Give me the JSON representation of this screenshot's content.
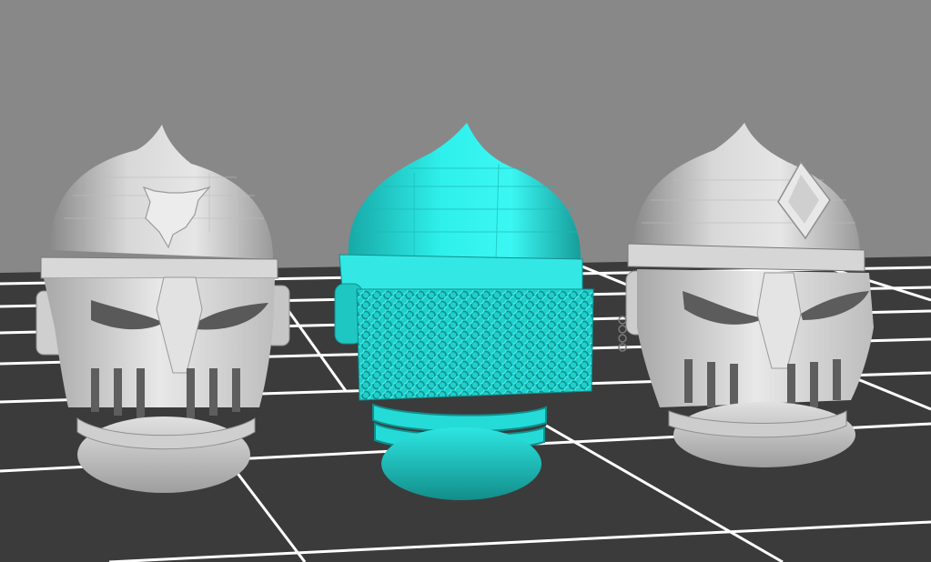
{
  "viewport": {
    "background_color": "#888888",
    "bed_color": "#3b3b3b",
    "grid_line_color": "#ffffff"
  },
  "models": [
    {
      "name": "helmet-wolf",
      "state": "unselected",
      "color": "#cfcfcf",
      "emblem": "wolf"
    },
    {
      "name": "helmet-chainmail",
      "state": "selected",
      "color": "#22e0dc",
      "emblem": "chainmail"
    },
    {
      "name": "helmet-diamond",
      "state": "unselected",
      "color": "#d4d4d4",
      "emblem": "diamond"
    }
  ]
}
